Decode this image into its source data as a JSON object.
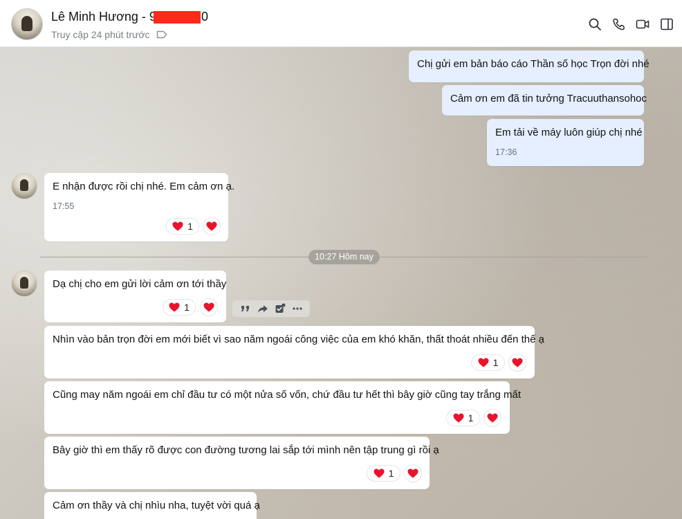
{
  "header": {
    "contact_name": "Lê Minh Hương - 9",
    "contact_name_tail": "0",
    "last_seen": "Truy cập 24 phút trước"
  },
  "messages_sent": [
    {
      "text": "Chị gửi em bản báo cáo Thần số học Trọn đời nhé"
    },
    {
      "text": "Cảm ơn em đã tin tưởng Tracuuthansohoc"
    },
    {
      "text": "Em tải về máy luôn giúp chị nhé",
      "time": "17:36"
    }
  ],
  "message_received_1": {
    "text": "E nhận được rồi chị nhé. Em cảm ơn ạ.",
    "time": "17:55",
    "reaction_count": "1"
  },
  "date_divider": "10:27 Hôm nay",
  "messages_received": [
    {
      "text": "Dạ chị cho em gửi lời cảm ơn tới thầy",
      "reaction_count": "1"
    },
    {
      "text": "Nhìn vào bản trọn đời em mới biết vì sao năm ngoái công việc của em khó khăn, thất thoát nhiều đến thế ạ",
      "reaction_count": "1"
    },
    {
      "text": "Cũng may năm ngoái em chỉ đầu tư có một nửa số vốn, chứ đầu tư hết thì bây giờ cũng tay trắng mất",
      "reaction_count": "1"
    },
    {
      "text": "Bây giờ thì em thấy rõ được con đường tương lai sắp tới mình nên tập trung gì rồi ạ",
      "reaction_count": "1"
    },
    {
      "text": "Cảm ơn thầy và chị nhìu nha, tuyệt vời quá ạ"
    }
  ],
  "icons": {
    "header": [
      "search-icon",
      "phone-icon",
      "video-call-icon",
      "sidebar-toggle-icon"
    ],
    "tag": "tag-icon",
    "reaction": "heart-icon",
    "message_actions": [
      "quote-icon",
      "forward-icon",
      "todo-icon",
      "more-icon"
    ]
  },
  "colors": {
    "sent_bubble": "#e5efff",
    "received_bubble": "#ffffff",
    "heart": "#e8132c",
    "redaction": "#ff2a1a"
  }
}
